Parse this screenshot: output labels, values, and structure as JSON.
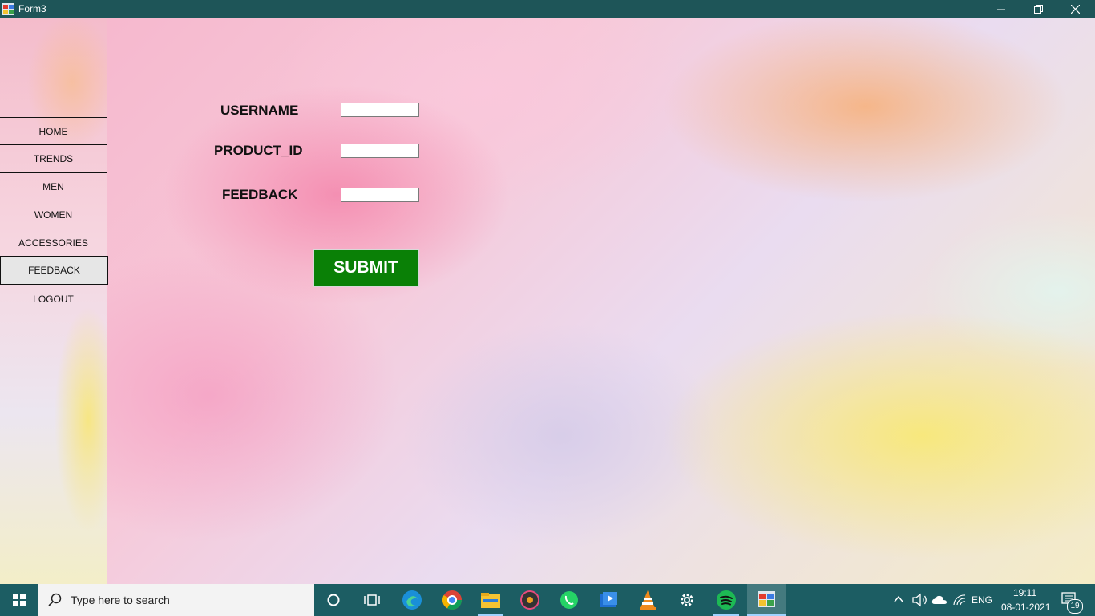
{
  "window": {
    "title": "Form3"
  },
  "sidebar": {
    "items": [
      {
        "label": "HOME",
        "active": false
      },
      {
        "label": "TRENDS",
        "active": false
      },
      {
        "label": "MEN",
        "active": false
      },
      {
        "label": "WOMEN",
        "active": false
      },
      {
        "label": "ACCESSORIES",
        "active": false
      },
      {
        "label": "FEEDBACK",
        "active": true
      },
      {
        "label": "LOGOUT",
        "active": false
      }
    ]
  },
  "form": {
    "username_label": "USERNAME",
    "username_value": "",
    "product_id_label": "PRODUCT_ID",
    "product_id_value": "",
    "feedback_label": "FEEDBACK",
    "feedback_value": "",
    "submit_label": "SUBMIT",
    "submit_color": "#0a8006"
  },
  "taskbar": {
    "search_placeholder": "Type here to search",
    "pinned_icons": [
      "cortana-icon",
      "task-view-icon",
      "edge-icon",
      "chrome-icon",
      "file-explorer-icon",
      "groove-music-icon",
      "whatsapp-icon",
      "media-player-icon",
      "vlc-icon",
      "settings-icon",
      "spotify-icon",
      "winforms-app-icon"
    ],
    "language": "ENG",
    "time": "19:11",
    "date": "08-01-2021",
    "notification_count": "19"
  }
}
